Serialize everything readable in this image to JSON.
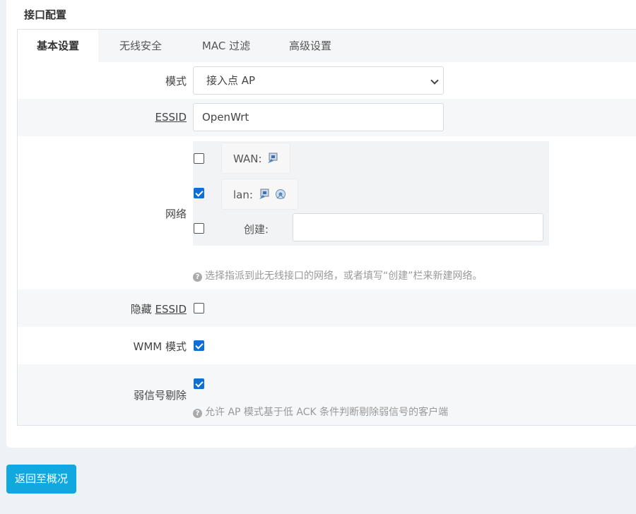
{
  "section_title": "接口配置",
  "tabs": [
    {
      "label": "基本设置",
      "active": true
    },
    {
      "label": "无线安全",
      "active": false
    },
    {
      "label": "MAC 过滤",
      "active": false
    },
    {
      "label": "高级设置",
      "active": false
    }
  ],
  "form": {
    "mode": {
      "label": "模式",
      "value": "接入点 AP"
    },
    "essid": {
      "label": "ESSID",
      "value": "OpenWrt"
    },
    "network": {
      "label": "网络",
      "options": [
        {
          "name": "WAN:",
          "checked": false
        },
        {
          "name": "lan:",
          "checked": true
        }
      ],
      "create_label": "创建:",
      "create_value": "",
      "help": "选择指派到此无线接口的网络，或者填写“创建”栏来新建网络。"
    },
    "hide_essid": {
      "label_prefix": "隐藏 ",
      "label_term": "ESSID",
      "checked": false
    },
    "wmm": {
      "label": "WMM 模式",
      "checked": true
    },
    "weak_signal": {
      "label": "弱信号剔除",
      "checked": true,
      "help": "允许 AP 模式基于低 ACK 条件判断剔除弱信号的客户端"
    }
  },
  "back_button": "返回至概况",
  "colors": {
    "accent": "#11a8e0",
    "checkbox": "#0d6fd1"
  },
  "icons": {
    "help": "question-circle-icon",
    "ethernet": "ethernet-port-icon",
    "wifi": "wifi-icon"
  }
}
